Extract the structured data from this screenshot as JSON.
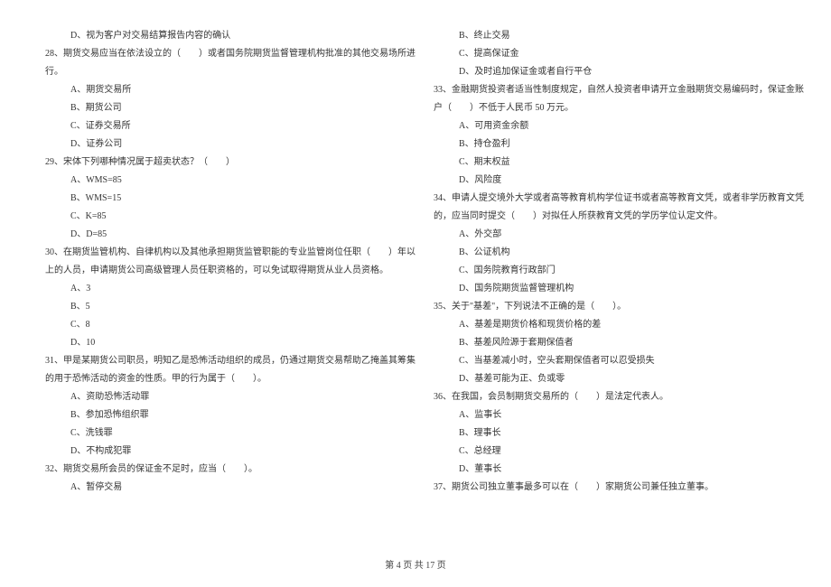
{
  "left": [
    {
      "cls": "indent1",
      "text": "D、视为客户对交易结算报告内容的确认"
    },
    {
      "cls": "indent0",
      "text": "28、期货交易应当在依法设立的（　　）或者国务院期货监督管理机构批准的其他交易场所进"
    },
    {
      "cls": "indent0",
      "text": "行。"
    },
    {
      "cls": "indent1",
      "text": "A、期货交易所"
    },
    {
      "cls": "indent1",
      "text": "B、期货公司"
    },
    {
      "cls": "indent1",
      "text": "C、证券交易所"
    },
    {
      "cls": "indent1",
      "text": "D、证券公司"
    },
    {
      "cls": "indent0",
      "text": "29、宋体下列哪种情况属于超卖状态？（　　）"
    },
    {
      "cls": "indent1",
      "text": "A、WMS=85"
    },
    {
      "cls": "indent1",
      "text": "B、WMS=15"
    },
    {
      "cls": "indent1",
      "text": "C、K=85"
    },
    {
      "cls": "indent1",
      "text": "D、D=85"
    },
    {
      "cls": "indent0",
      "text": "30、在期货监管机构、自律机构以及其他承担期货监管职能的专业监管岗位任职（　　）年以"
    },
    {
      "cls": "indent0",
      "text": "上的人员，申请期货公司高级管理人员任职资格的，可以免试取得期货从业人员资格。"
    },
    {
      "cls": "indent1",
      "text": "A、3"
    },
    {
      "cls": "indent1",
      "text": "B、5"
    },
    {
      "cls": "indent1",
      "text": "C、8"
    },
    {
      "cls": "indent1",
      "text": "D、10"
    },
    {
      "cls": "indent0",
      "text": "31、甲是某期货公司职员，明知乙是恐怖活动组织的成员，仍通过期货交易帮助乙掩盖其筹集"
    },
    {
      "cls": "indent0",
      "text": "的用于恐怖活动的资金的性质。甲的行为属于（　　）。"
    },
    {
      "cls": "indent1",
      "text": "A、资助恐怖活动罪"
    },
    {
      "cls": "indent1",
      "text": "B、参加恐怖组织罪"
    },
    {
      "cls": "indent1",
      "text": "C、洗钱罪"
    },
    {
      "cls": "indent1",
      "text": "D、不构成犯罪"
    },
    {
      "cls": "indent0",
      "text": "32、期货交易所会员的保证金不足时，应当（　　）。"
    },
    {
      "cls": "indent1",
      "text": "A、暂停交易"
    }
  ],
  "right": [
    {
      "cls": "indent1",
      "text": "B、终止交易"
    },
    {
      "cls": "indent1",
      "text": "C、提高保证金"
    },
    {
      "cls": "indent1",
      "text": "D、及时追加保证金或者自行平仓"
    },
    {
      "cls": "indent0",
      "text": "33、金融期货投资者适当性制度规定，自然人投资者申请开立金融期货交易编码时，保证金账"
    },
    {
      "cls": "indent0",
      "text": "户（　　）不低于人民币 50 万元。"
    },
    {
      "cls": "indent1",
      "text": "A、可用资金余额"
    },
    {
      "cls": "indent1",
      "text": "B、持仓盈利"
    },
    {
      "cls": "indent1",
      "text": "C、期末权益"
    },
    {
      "cls": "indent1",
      "text": "D、风险度"
    },
    {
      "cls": "indent0",
      "text": "34、申请人提交境外大学或者高等教育机构学位证书或者高等教育文凭，或者非学历教育文凭"
    },
    {
      "cls": "indent0",
      "text": "的，应当同时提交（　　）对拟任人所获教育文凭的学历学位认定文件。"
    },
    {
      "cls": "indent1",
      "text": "A、外交部"
    },
    {
      "cls": "indent1",
      "text": "B、公证机构"
    },
    {
      "cls": "indent1",
      "text": "C、国务院教育行政部门"
    },
    {
      "cls": "indent1",
      "text": "D、国务院期货监督管理机构"
    },
    {
      "cls": "indent0",
      "text": "35、关于\"基差\"，下列说法不正确的是（　　）。"
    },
    {
      "cls": "indent1",
      "text": "A、基差是期货价格和现货价格的差"
    },
    {
      "cls": "indent1",
      "text": "B、基差风险源于套期保值者"
    },
    {
      "cls": "indent1",
      "text": "C、当基差减小时，空头套期保值者可以忍受损失"
    },
    {
      "cls": "indent1",
      "text": "D、基差可能为正、负或零"
    },
    {
      "cls": "indent0",
      "text": "36、在我国，会员制期货交易所的（　　）是法定代表人。"
    },
    {
      "cls": "indent1",
      "text": "A、监事长"
    },
    {
      "cls": "indent1",
      "text": "B、理事长"
    },
    {
      "cls": "indent1",
      "text": "C、总经理"
    },
    {
      "cls": "indent1",
      "text": "D、董事长"
    },
    {
      "cls": "indent0",
      "text": "37、期货公司独立董事最多可以在（　　）家期货公司兼任独立董事。"
    }
  ],
  "footer": "第 4 页 共 17 页"
}
